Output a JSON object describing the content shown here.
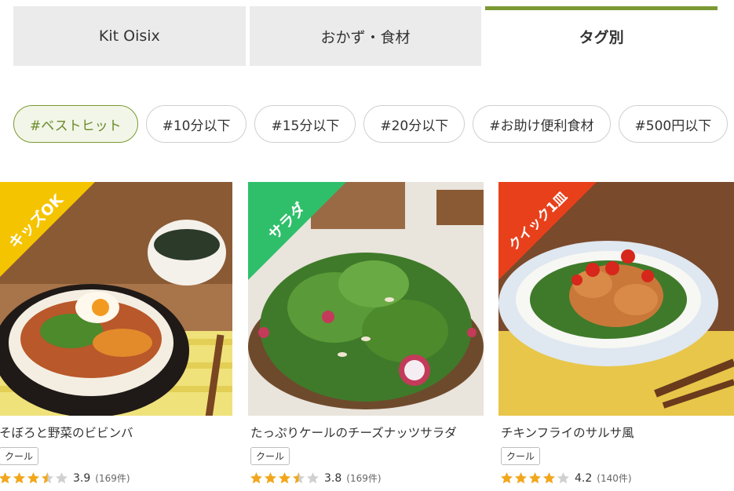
{
  "tabs": [
    {
      "label": "Kit Oisix",
      "active": false
    },
    {
      "label": "おかず・食材",
      "active": false
    },
    {
      "label": "タグ別",
      "active": true
    }
  ],
  "chips": [
    {
      "label": "#ベストヒット",
      "active": true
    },
    {
      "label": "#10分以下",
      "active": false
    },
    {
      "label": "#15分以下",
      "active": false
    },
    {
      "label": "#20分以下",
      "active": false
    },
    {
      "label": "#お助け便利食材",
      "active": false
    },
    {
      "label": "#500円以下",
      "active": false
    }
  ],
  "cards": [
    {
      "ribbon": "キッズOK",
      "ribbon_color": "#f5c400",
      "title": "そぼろと野菜のビビンバ",
      "badge": "クール",
      "rating": 3.5,
      "score": "3.9",
      "count": "(169件)",
      "image": "bibimbap-photo"
    },
    {
      "ribbon": "サラダ",
      "ribbon_color": "#2fbf6a",
      "title": "たっぷりケールのチーズナッツサラダ",
      "badge": "クール",
      "rating": 3.5,
      "score": "3.8",
      "count": "(169件)",
      "image": "kale-salad-photo"
    },
    {
      "ribbon": "クイック1皿",
      "ribbon_color": "#e8401b",
      "title": "チキンフライのサルサ風",
      "badge": "クール",
      "rating": 4,
      "score": "4.2",
      "count": "(140件)",
      "image": "chicken-salsa-photo"
    }
  ],
  "colors": {
    "accent": "#7b9a34",
    "star": "#f2a71b",
    "star_empty": "#d0d0d0"
  }
}
